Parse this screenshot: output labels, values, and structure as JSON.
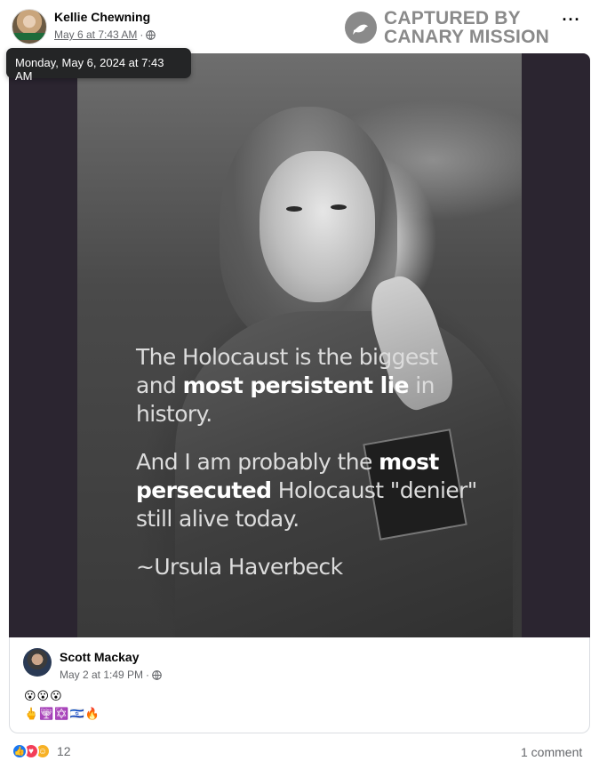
{
  "post": {
    "author": "Kellie Chewning",
    "timestamp": "May 6 at 7:43 AM",
    "separator": "·",
    "privacy_icon": "globe-icon",
    "tooltip": "Monday, May 6, 2024 at 7:43 AM",
    "more_label": "···"
  },
  "watermark": {
    "line1": "CAPTURED BY",
    "line2": "CANARY MISSION",
    "icon": "canary-bird-icon"
  },
  "image_text": {
    "line1_a": "The Holocaust is the biggest",
    "line2_a": "and ",
    "line2_b": "most persistent lie",
    "line2_c": " in",
    "line3": "history.",
    "line4_a": "And I am probably the ",
    "line4_b": "most",
    "line5_a": "persecuted",
    "line5_b": " Holocaust \"denier\"",
    "line6": "still alive today.",
    "attribution": "~Ursula Haverbeck"
  },
  "comment": {
    "author": "Scott Mackay",
    "timestamp": "May 2 at 1:49 PM",
    "separator": "·",
    "line1": "😮😮😮",
    "line2": "🖕🕎✡️🇮🇱🔥"
  },
  "footer": {
    "reaction_icons": [
      "like-icon",
      "love-icon",
      "care-icon"
    ],
    "reaction_count": "12",
    "comment_count": "1 comment"
  },
  "colors": {
    "facebook_blue": "#1877f2",
    "love_red": "#f33e58",
    "care_yellow": "#f7b125",
    "tooltip_bg": "#242526",
    "watermark_gray": "#8a8a8a"
  }
}
